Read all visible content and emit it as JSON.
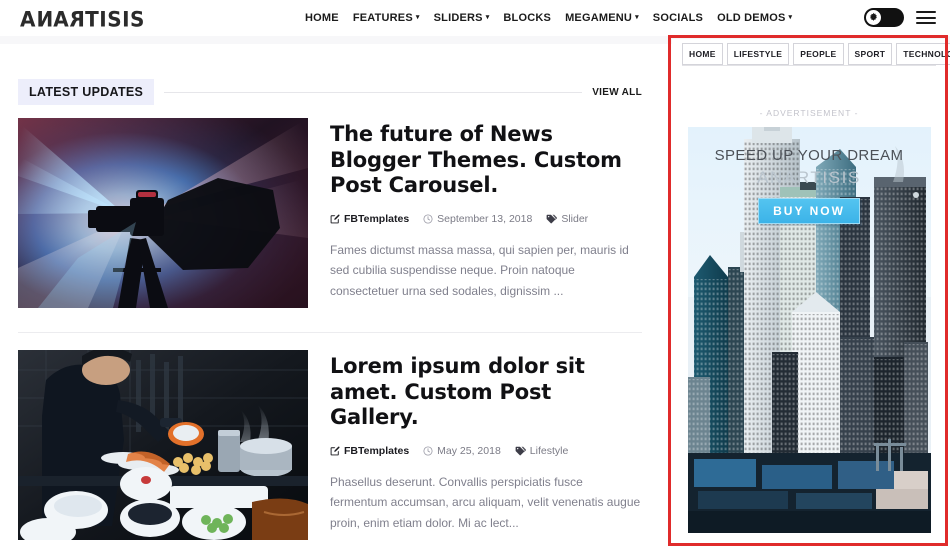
{
  "header": {
    "brand": "ANARTISIS",
    "nav": [
      {
        "label": "HOME",
        "has_dropdown": false
      },
      {
        "label": "FEATURES",
        "has_dropdown": true
      },
      {
        "label": "SLIDERS",
        "has_dropdown": true
      },
      {
        "label": "BLOCKS",
        "has_dropdown": false
      },
      {
        "label": "MEGAMENU",
        "has_dropdown": true
      },
      {
        "label": "SOCIALS",
        "has_dropdown": false
      },
      {
        "label": "OLD DEMOS",
        "has_dropdown": true
      }
    ],
    "mode_toggle_icon": "gear-icon",
    "menu_icon": "hamburger-icon"
  },
  "main": {
    "section_title": "LATEST UPDATES",
    "view_all": "VIEW ALL",
    "posts": [
      {
        "title": "The future of News Blogger Themes. Custom Post Carousel.",
        "author": "FBTemplates",
        "date": "September 13, 2018",
        "category": "Slider",
        "excerpt": "Fames dictumst massa massa, qui sapien per, mauris id sed cubilia suspendisse neque. Proin natoque consectetuer urna sed sodales, dignissim ...",
        "image_alt": "video-camera-silhouette-with-stage-lights"
      },
      {
        "title": "Lorem ipsum dolor sit amet. Custom Post Gallery.",
        "author": "FBTemplates",
        "date": "May 25, 2018",
        "category": "Lifestyle",
        "excerpt": "Phasellus deserunt. Convallis perspiciatis fusce fermentum accumsan, arcu aliquam, velit venenatis augue proin, enim etiam dolor. Mi ac lect...",
        "image_alt": "chef-preparing-food-in-dark-kitchen"
      }
    ]
  },
  "sidebar": {
    "tabs": [
      {
        "label": "HOME",
        "active": false
      },
      {
        "label": "LIFESTYLE",
        "active": false
      },
      {
        "label": "PEOPLE",
        "active": false
      },
      {
        "label": "SPORT",
        "active": false
      },
      {
        "label": "TECHNOLOGY",
        "active": false
      }
    ],
    "ad_label": "- ADVERTISEMENT -",
    "ad": {
      "headline": "SPEED UP YOUR DREAM",
      "brand": "ANARTISIS",
      "cta": "BUY NOW",
      "image_alt": "city-skyline-skyscrapers"
    }
  },
  "annotation": {
    "color": "#e02b2b",
    "target": "sidebar-region"
  }
}
